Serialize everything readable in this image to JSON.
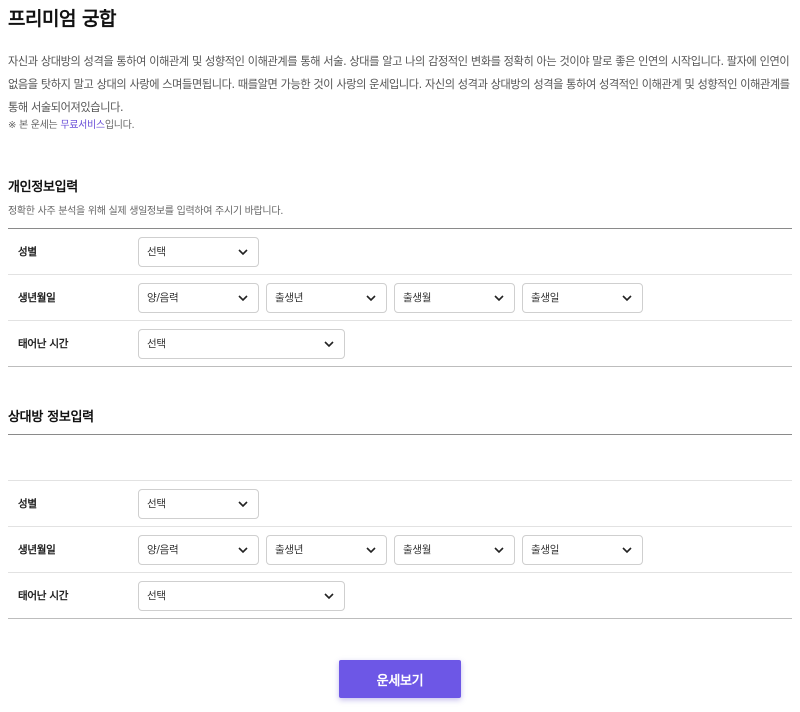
{
  "title": "프리미엄 궁합",
  "description": "자신과 상대방의 성격을 통하여 이해관계 및 성향적인 이해관계를 통해 서술. 상대를 알고 나의 감정적인 변화를 정확히 아는 것이야 말로 좋은 인연의 시작입니다. 팔자에 인연이 없음을 탓하지 말고 상대의 사랑에 스며들면됩니다. 때를알면 가능한 것이 사랑의 운세입니다. 자신의 성격과 상대방의 성격을 통하여 성격적인 이해관계 및 성향적인 이해관계를 통해 서술되어져있습니다.",
  "note": {
    "prefix": "※ 본 운세는 ",
    "link": "무료서비스",
    "suffix": "입니다."
  },
  "personal": {
    "title": "개인정보입력",
    "subtitle": "정확한 사주 분석을 위해 실제 생일정보를 입력하여 주시기 바랍니다.",
    "gender_label": "성별",
    "gender_value": "선택",
    "birth_label": "생년월일",
    "calendar_value": "양/음력",
    "year_value": "출생년",
    "month_value": "출생월",
    "day_value": "출생일",
    "time_label": "태어난 시간",
    "time_value": "선택"
  },
  "partner": {
    "title": "상대방 정보입력",
    "gender_label": "성별",
    "gender_value": "선택",
    "birth_label": "생년월일",
    "calendar_value": "양/음력",
    "year_value": "출생년",
    "month_value": "출생월",
    "day_value": "출생일",
    "time_label": "태어난 시간",
    "time_value": "선택"
  },
  "submit_label": "운세보기",
  "colors": {
    "accent": "#6d57e6",
    "link": "#6a4fd8"
  }
}
